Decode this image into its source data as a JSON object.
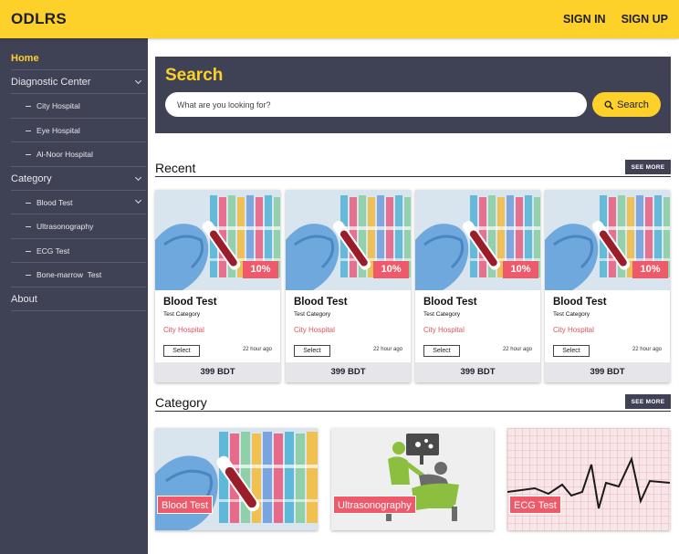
{
  "header": {
    "brand": "ODLRS",
    "sign_in": "SIGN IN",
    "sign_up": "SIGN UP"
  },
  "sidebar": {
    "home": "Home",
    "diagnostic_center": {
      "label": "Diagnostic Center",
      "items": [
        "City Hospital",
        "Eye Hospital",
        "Al-Noor Hospital"
      ]
    },
    "category": {
      "label": "Category",
      "items": [
        "Blood Test",
        "Ultrasonography",
        "ECG Test",
        "Bone-marrow  Test"
      ]
    },
    "about": "About"
  },
  "search": {
    "title": "Search",
    "placeholder": "What are you looking for?",
    "button": "Search"
  },
  "recent": {
    "title": "Recent",
    "see_more": "SEE MORE",
    "cards": [
      {
        "title": "Blood Test",
        "category": "Test Category",
        "hospital": "City Hospital",
        "discount": "10%",
        "select": "Select",
        "time": "22 hour ago",
        "price": "399 BDT"
      },
      {
        "title": "Blood Test",
        "category": "Test Category",
        "hospital": "City Hospital",
        "discount": "10%",
        "select": "Select",
        "time": "22 hour ago",
        "price": "399 BDT"
      },
      {
        "title": "Blood Test",
        "category": "Test Category",
        "hospital": "City Hospital",
        "discount": "10%",
        "select": "Select",
        "time": "22 hour ago",
        "price": "399 BDT"
      },
      {
        "title": "Blood Test",
        "category": "Test Category",
        "hospital": "City Hospital",
        "discount": "10%",
        "select": "Select",
        "time": "22 hour ago",
        "price": "399 BDT"
      }
    ]
  },
  "categories": {
    "title": "Category",
    "see_more": "SEE MORE",
    "tiles": [
      {
        "label": "Blood Test",
        "icon": "blood-test-tubes-image"
      },
      {
        "label": "Ultrasonography",
        "icon": "ultrasonography-illustration"
      },
      {
        "label": "ECG Test",
        "icon": "ecg-chart-image"
      }
    ]
  },
  "colors": {
    "accent": "#fdd02a",
    "dark": "#3f4154",
    "badge": "#ee5a6a"
  }
}
